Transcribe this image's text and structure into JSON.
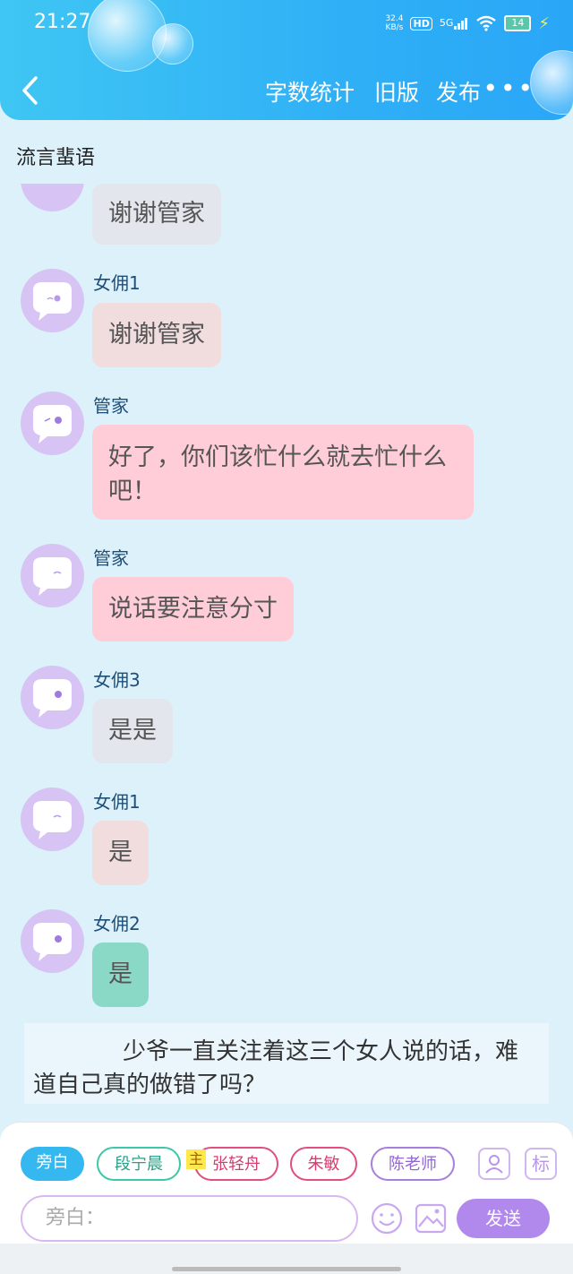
{
  "status": {
    "time": "21:27",
    "net_speed_value": "32.4",
    "net_speed_unit": "KB/s",
    "hd": "HD",
    "sig": "5G",
    "battery": "14"
  },
  "header": {
    "word_count": "字数统计",
    "old_version": "旧版",
    "publish": "发布",
    "more": "•••"
  },
  "chat_title": "流言蜚语",
  "messages": [
    {
      "speaker": "",
      "text": "谢谢管家",
      "color": "#e3e6ec"
    },
    {
      "speaker": "女佣1",
      "text": "谢谢管家",
      "color": "#f1dddd"
    },
    {
      "speaker": "管家",
      "text_line1": "好了，你们该忙什么就去忙什么",
      "text_line2": "吧！",
      "color": "#ffcdd8"
    },
    {
      "speaker": "管家",
      "text": "说话要注意分寸",
      "color": "#ffcdd8"
    },
    {
      "speaker": "女佣3",
      "text": "是是",
      "color": "#e3e6ec"
    },
    {
      "speaker": "女佣1",
      "text": "是",
      "color": "#f1dddd"
    },
    {
      "speaker": "女佣2",
      "text": "是",
      "color": "#8ad8c6"
    }
  ],
  "narration": "少爷一直关注着这三个女人说的话，难道自己真的做错了吗？",
  "roles": {
    "narrator": "旁白",
    "r1": "段宁晨",
    "main_tag": "主",
    "r2": "张轻舟",
    "r3": "朱敏",
    "r4": "陈老师",
    "mark": "标"
  },
  "input": {
    "placeholder": "旁白："
  },
  "send": "发送",
  "colors": {
    "accent": "#2fb0f6",
    "send": "#b189ec",
    "avatar": "#d7c4f4"
  }
}
